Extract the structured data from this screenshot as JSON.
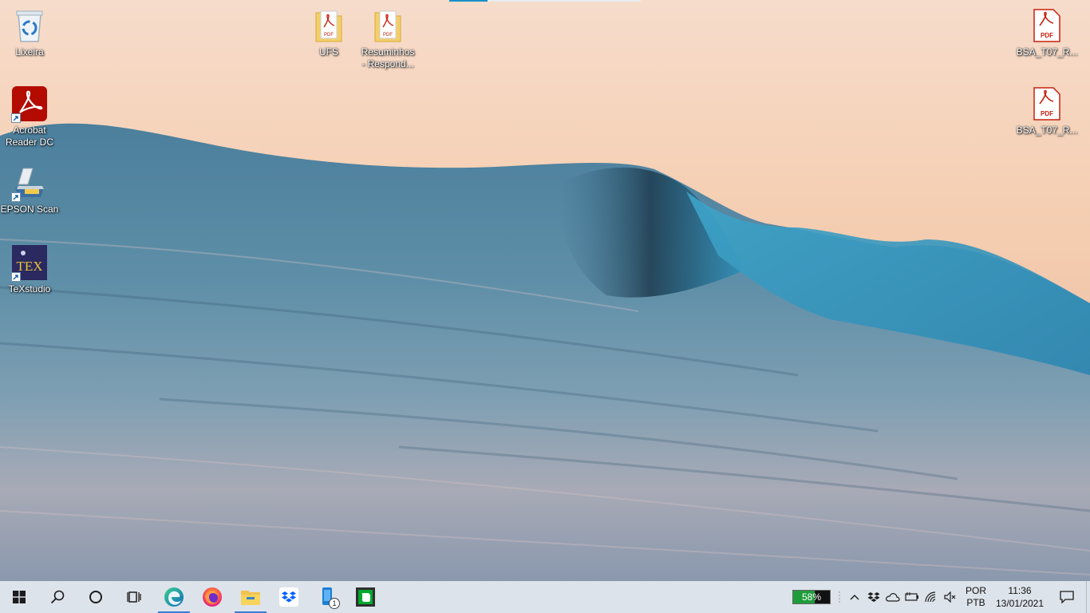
{
  "desktop": {
    "icons": {
      "recycle_bin": "Lixeira",
      "acrobat": "Acrobat Reader DC",
      "epson": "EPSON Scan",
      "texstudio": "TeXstudio",
      "ufs": "UFS",
      "resuminhos": "Resuminhos - Respond...",
      "bsa1": "BSA_T07_R...",
      "bsa2": "BSA_T07_R..."
    },
    "pdf_badge": "PDF",
    "tex_badge": "TEX"
  },
  "taskbar": {
    "start_icon": "windows-logo-icon",
    "search_icon": "search-icon",
    "cortana_icon": "cortana-circle-icon",
    "taskview_icon": "task-view-icon",
    "pinned": [
      "edge-icon",
      "firefox-icon",
      "file-explorer-icon",
      "dropbox-icon",
      "phone-app-icon",
      "evernote-icon"
    ],
    "phone_badge": "1",
    "battery": {
      "percent_label": "58%",
      "level": 0.58
    },
    "language": {
      "line1": "POR",
      "line2": "PTB"
    },
    "clock": {
      "time": "11:36",
      "date": "13/01/2021"
    }
  },
  "colors": {
    "taskbar_bg": "#dde3ea",
    "accent": "#3a7bd5",
    "battery_fill": "#1f9c3a"
  }
}
